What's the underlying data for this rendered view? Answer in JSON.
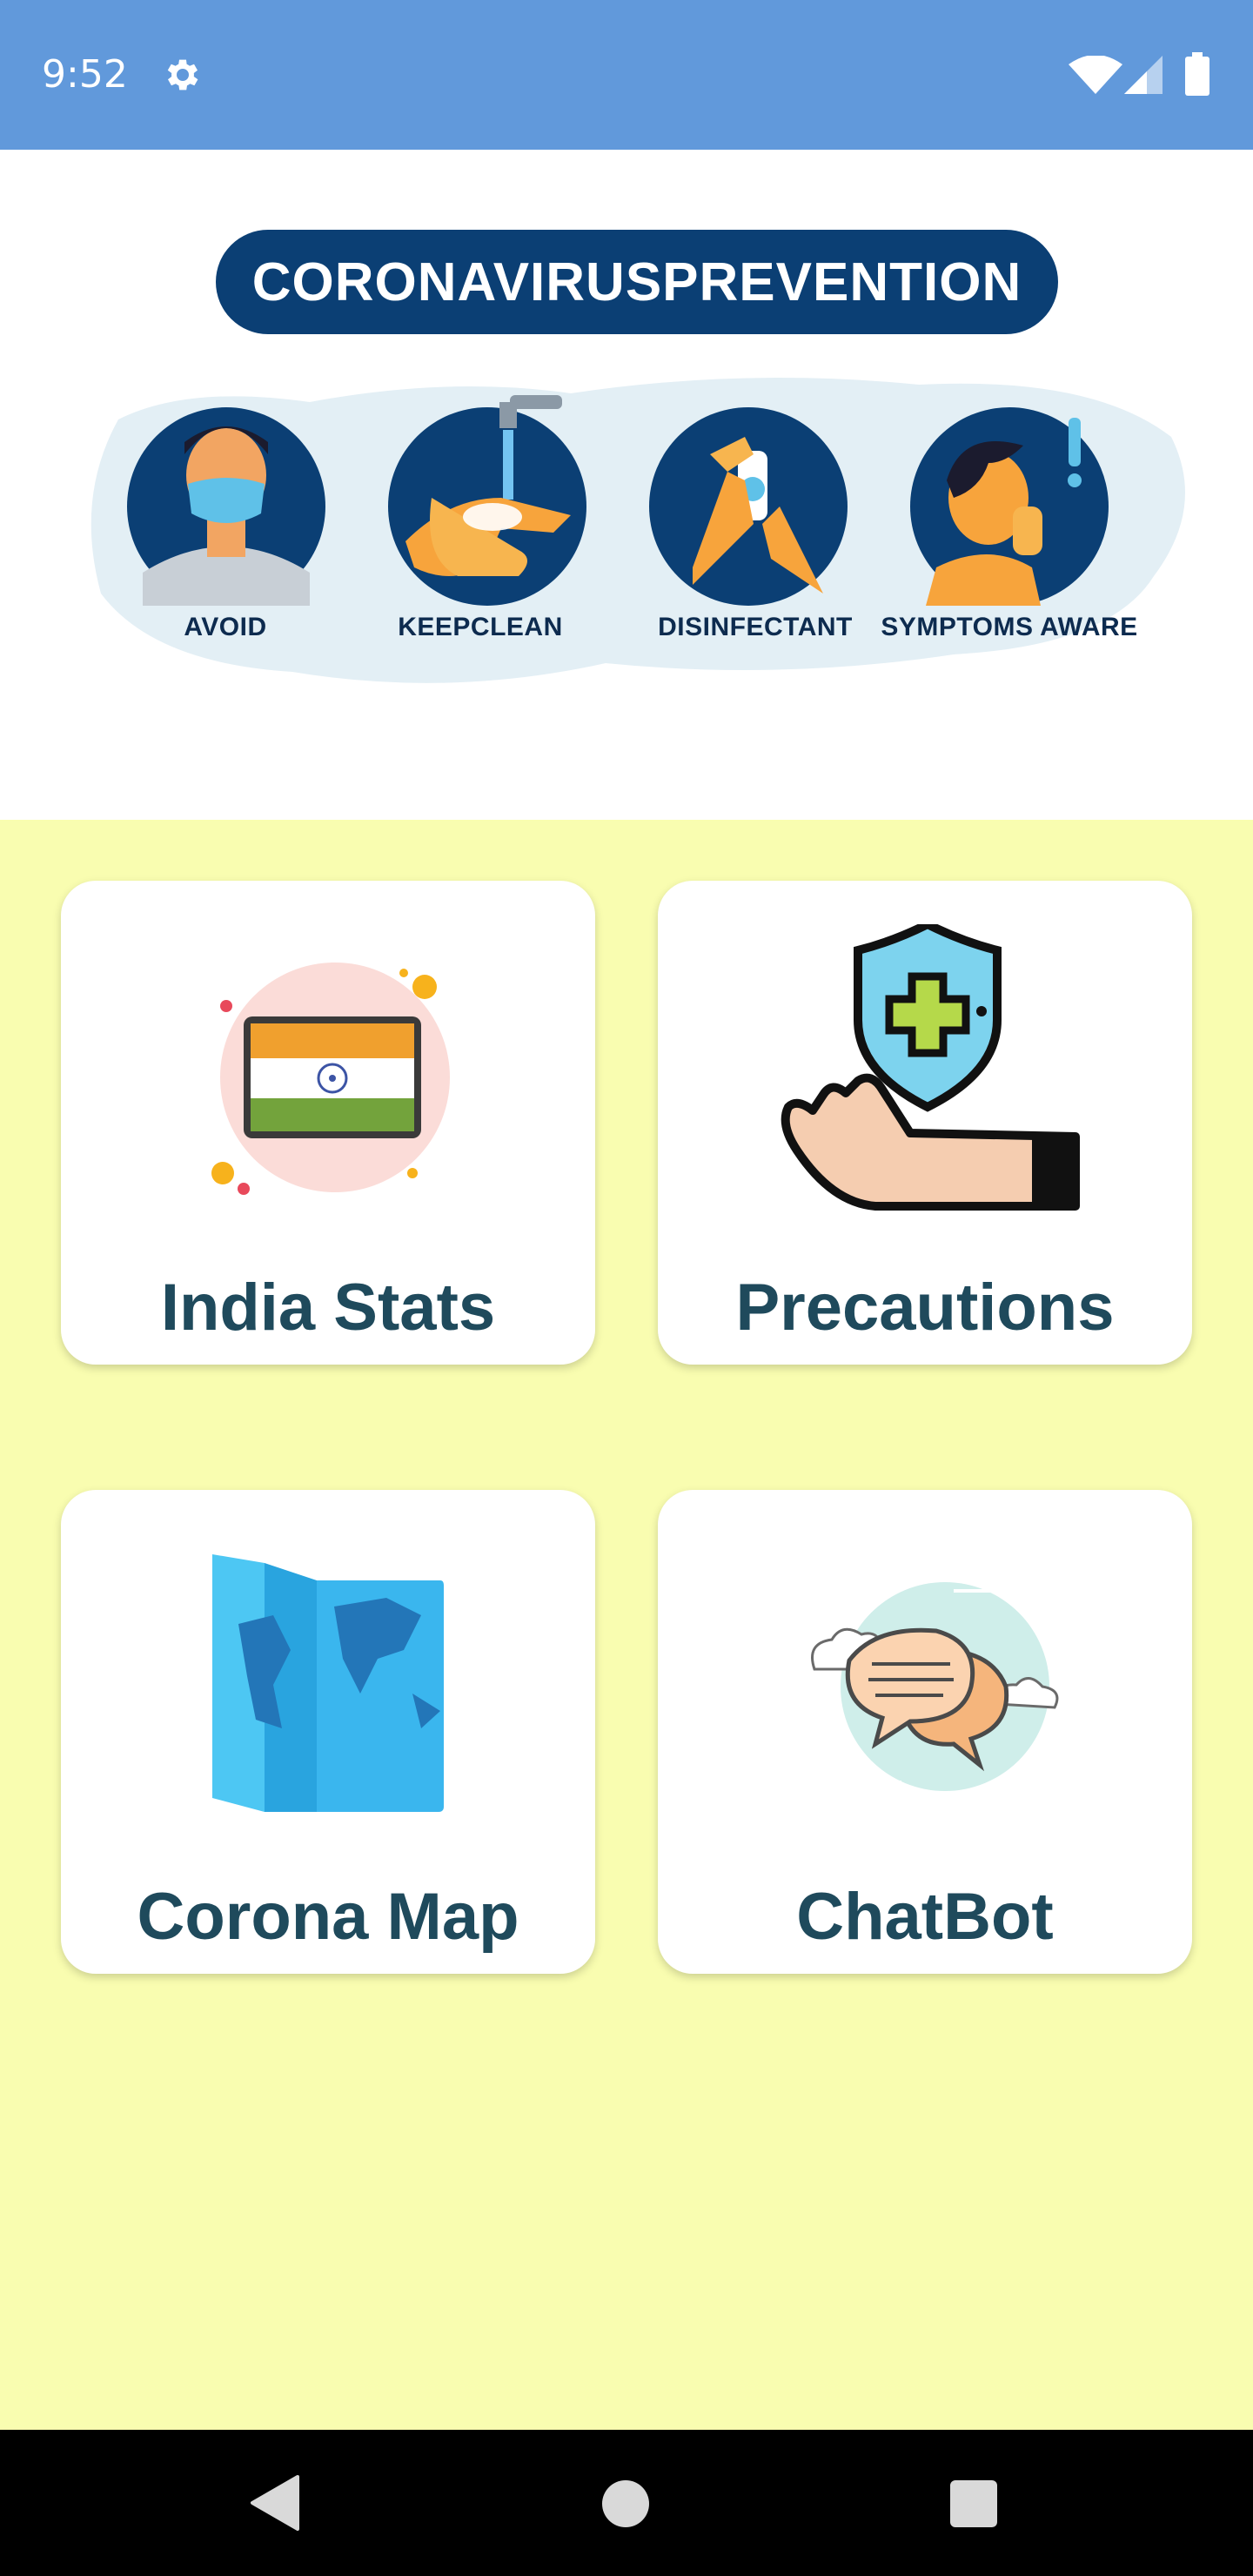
{
  "status_bar": {
    "time": "9:52",
    "icons": [
      "gear-icon",
      "wifi-icon",
      "signal-icon",
      "battery-icon"
    ],
    "background": "#6199db"
  },
  "banner": {
    "title": "CORONAVIRUSPREVENTION",
    "steps": [
      {
        "label": "AVOID",
        "icon": "mask-person-icon"
      },
      {
        "label": "KEEPCLEAN",
        "icon": "handwash-icon"
      },
      {
        "label": "DISINFECTANT",
        "icon": "sanitizer-icon"
      },
      {
        "label": "SYMPTOMS AWARE",
        "icon": "coughing-person-icon"
      }
    ],
    "pill_color": "#0b3f74"
  },
  "menu": {
    "background": "#f9fdb0",
    "cards": [
      {
        "label": "India Stats",
        "icon": "india-flag-icon"
      },
      {
        "label": "Precautions",
        "icon": "shield-hand-icon"
      },
      {
        "label": "Corona Map",
        "icon": "map-icon"
      },
      {
        "label": "ChatBot",
        "icon": "chat-bubbles-icon"
      }
    ]
  },
  "nav_bar": {
    "buttons": [
      "back-icon",
      "home-icon",
      "recent-apps-icon"
    ]
  }
}
